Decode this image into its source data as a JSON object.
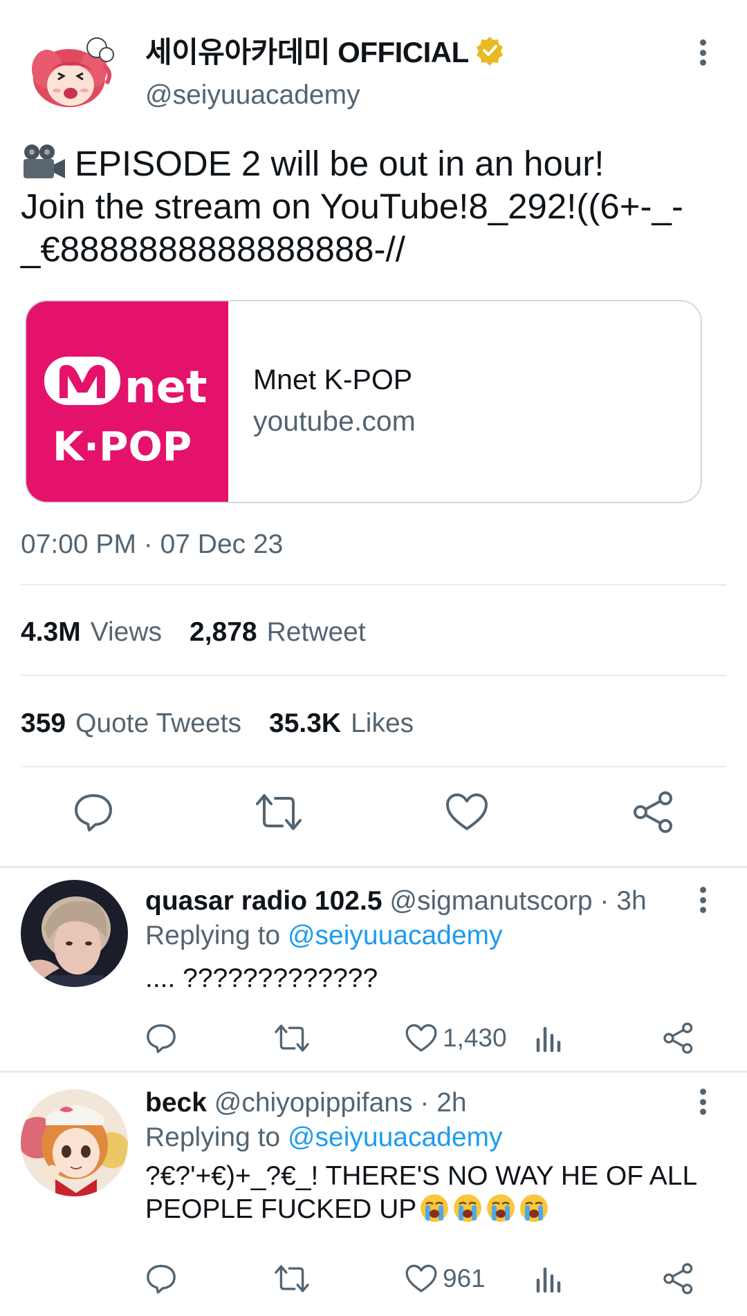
{
  "tweet": {
    "author_name": "세이유아카데미 OFFICIAL",
    "author_handle": "@seiyuuacademy",
    "text_lines": [
      "EPISODE 2 will be out in an hour!",
      "Join the stream on YouTube!8_292!((6+-_-",
      "_€8888888888888888-//"
    ],
    "card": {
      "logo_line1": "net",
      "logo_line2": "K·POP",
      "title": "Mnet K-POP",
      "domain": "youtube.com"
    },
    "timestamp": "07:00 PM · 07 Dec 23",
    "stats": {
      "views_count": "4.3M",
      "views_label": "Views",
      "retweets_count": "2,878",
      "retweets_label": "Retweet",
      "quotes_count": "359",
      "quotes_label": "Quote Tweets",
      "likes_count": "35.3K",
      "likes_label": "Likes"
    }
  },
  "replies": [
    {
      "name": "quasar radio 102.5",
      "handle": "@sigmanutscorp",
      "sep": "·",
      "time": "3h",
      "replying_prefix": "Replying to",
      "replying_to": "@seiyuuacademy",
      "text_lines": [
        ".... ?????????????"
      ],
      "like_count": "1,430"
    },
    {
      "name": "beck",
      "handle": "@chiyopippifans",
      "sep": "·",
      "time": "2h",
      "replying_prefix": "Replying to",
      "replying_to": "@seiyuuacademy",
      "text_lines": [
        "?€?'+€)+_?€_! THERE'S NO WAY HE OF ALL",
        "PEOPLE FUCKED UP"
      ],
      "like_count": "961"
    }
  ],
  "colors": {
    "accent_blue": "#1d9bf0",
    "secondary_text": "#536471",
    "card_brand": "#e4126b",
    "verified_gold": "#e8b923"
  }
}
